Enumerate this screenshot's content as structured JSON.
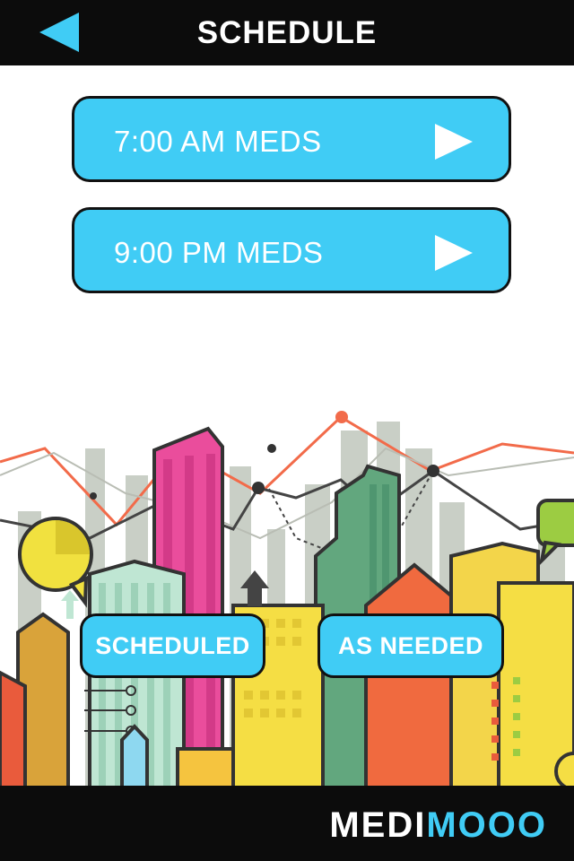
{
  "header": {
    "title": "SCHEDULE",
    "back_icon": "back-arrow-icon"
  },
  "schedule_items": [
    {
      "label": "7:00 AM MEDS",
      "icon": "play-icon"
    },
    {
      "label": "9:00 PM MEDS",
      "icon": "play-icon"
    }
  ],
  "tabs": {
    "scheduled": "SCHEDULED",
    "as_needed": "AS NEEDED"
  },
  "footer": {
    "brand_part1": "MEDI",
    "brand_part2": "MOOO"
  },
  "colors": {
    "accent": "#40ccf5",
    "bar": "#0c0c0c"
  }
}
